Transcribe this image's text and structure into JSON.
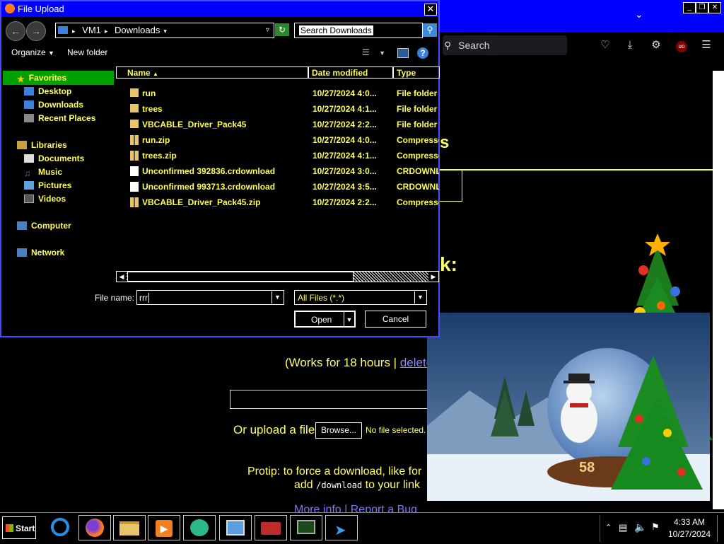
{
  "dialog": {
    "title": "File Upload",
    "address": [
      "VM1",
      "Downloads"
    ],
    "search_placeholder": "Search Downloads",
    "toolbar": {
      "organize": "Organize",
      "new_folder": "New folder"
    },
    "nav": {
      "favorites": "Favorites",
      "desktop": "Desktop",
      "downloads": "Downloads",
      "recent": "Recent Places",
      "libraries": "Libraries",
      "documents": "Documents",
      "music": "Music",
      "pictures": "Pictures",
      "videos": "Videos",
      "computer": "Computer",
      "network": "Network"
    },
    "columns": {
      "name": "Name",
      "date": "Date modified",
      "type": "Type"
    },
    "files": [
      {
        "name": "run",
        "date": "10/27/2024 4:0...",
        "type": "File folder",
        "icon": "folder"
      },
      {
        "name": "trees",
        "date": "10/27/2024 4:1...",
        "type": "File folder",
        "icon": "folder"
      },
      {
        "name": "VBCABLE_Driver_Pack45",
        "date": "10/27/2024 2:2...",
        "type": "File folder",
        "icon": "folder"
      },
      {
        "name": "run.zip",
        "date": "10/27/2024 4:0...",
        "type": "Compressed",
        "icon": "zip"
      },
      {
        "name": "trees.zip",
        "date": "10/27/2024 4:1...",
        "type": "Compressed",
        "icon": "zip"
      },
      {
        "name": "Unconfirmed 392836.crdownload",
        "date": "10/27/2024 3:0...",
        "type": "CRDOWNLOAD",
        "icon": "file"
      },
      {
        "name": "Unconfirmed 993713.crdownload",
        "date": "10/27/2024 3:5...",
        "type": "CRDOWNLOAD",
        "icon": "file"
      },
      {
        "name": "VBCABLE_Driver_Pack45.zip",
        "date": "10/27/2024 2:2...",
        "type": "Compressed",
        "icon": "zip"
      }
    ],
    "file_name_label": "File name:",
    "file_name_value": "rrr",
    "file_type": "All Files (*.*)",
    "open": "Open",
    "cancel": "Cancel"
  },
  "browser": {
    "search_placeholder": "Search",
    "page": {
      "works_for": "(Works for 18 hours | ",
      "delete": "delete",
      "works_close": ")",
      "upload_label": "Or upload a file:",
      "browse": "Browse...",
      "no_file": "No file selected.",
      "protip_line1": "Protip: to force a download, like for",
      "protip_line2a": "add ",
      "protip_code": "/download",
      "protip_line2b": " to your link",
      "more_info": "More info",
      "report_bug": "Report a Bug"
    }
  },
  "taskbar": {
    "start": "Start",
    "time": "4:33 AM",
    "date": "10/27/2024"
  },
  "colors": {
    "high_contrast_text": "#ffff55",
    "title_bar": "#0000ff",
    "selection": "#00a000"
  }
}
